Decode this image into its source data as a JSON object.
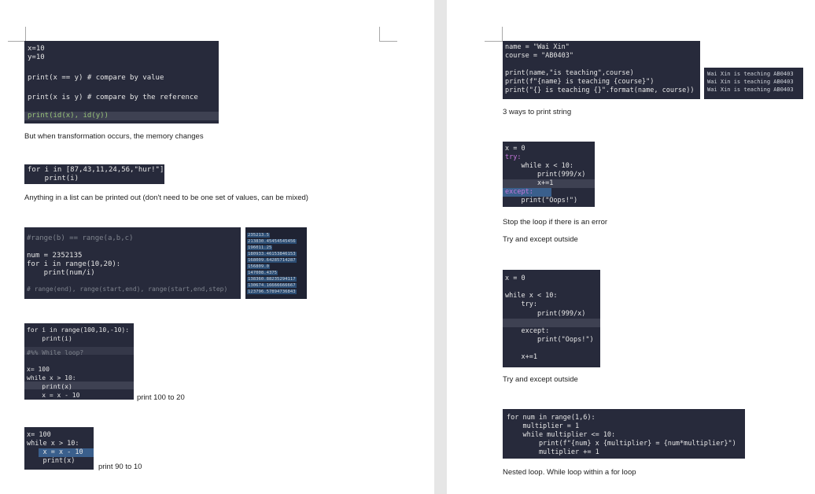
{
  "page1": {
    "block1": {
      "lines": [
        "x=10",
        "y=10",
        "print(x == y) # compare by value",
        "print(x is y) # compare by the reference",
        "print(id(x), id(y))"
      ]
    },
    "note1": "But when transformation occurs, the memory changes",
    "block2": {
      "lines": [
        "for i in [87,43,11,24,56,\"hur!\"]:",
        "    print(i)"
      ]
    },
    "note2": "Anything in a list can be printed out (don't need to be one set of values, can be mixed)",
    "block3": {
      "lines": [
        "#range(b) == range(a,b,c)",
        "num = 2352135",
        "for i in range(10,20):",
        "    print(num/i)",
        "# range(end), range(start,end), range(start,end,step)"
      ],
      "outputs": [
        "235213.5",
        "213830.45454545456",
        "196011.25",
        "180933.46153846153",
        "168009.64285714287",
        "156809.0",
        "147008.4375",
        "138360.88235294117",
        "130674.16666666667",
        "123796.57894736843"
      ]
    },
    "block4": {
      "lines": [
        "for i in range(100,10,-10):",
        "    print(i)",
        "#%% While loop?",
        "x= 100",
        "while x > 10:",
        "    print(x)",
        "    x = x - 10"
      ]
    },
    "note4": "print 100 to 20",
    "block5": {
      "lines": [
        "x= 100",
        "while x > 10:",
        "    x = x - 10",
        "    print(x)"
      ]
    },
    "note5": "print 90 to 10"
  },
  "page2": {
    "block1": {
      "lines": [
        "name = \"Wai Xin\"",
        "course = \"AB0403\"",
        "print(name,\"is teaching\",course)",
        "print(f\"{name} is teaching {course}\")",
        "print(\"{} is teaching {}\".format(name, course))"
      ],
      "outputs": [
        "Wai Xin is teaching AB0403",
        "Wai Xin is teaching AB0403",
        "Wai Xin is teaching AB0403"
      ]
    },
    "note1": "3 ways to print string",
    "block2": {
      "lines": [
        "x = 0",
        "try:",
        "    while x < 10:",
        "        print(999/x)",
        "        x+=1",
        "except:",
        "    print(\"Oops!\")"
      ]
    },
    "note2a": "Stop the loop if there is an error",
    "note2b": "Try and except outside",
    "block3": {
      "lines": [
        "x = 0",
        "while x < 10:",
        "    try:",
        "        print(999/x)",
        "    except:",
        "        print(\"Oops!\")",
        "    x+=1"
      ]
    },
    "note3": "Try and except outside",
    "block4": {
      "lines": [
        "for num in range(1,6):",
        "    multiplier = 1",
        "    while multiplier <= 10:",
        "        print(f\"{num} x {multiplier} = {num*multiplier}\")",
        "        multiplier += 1"
      ]
    },
    "note4": "Nested loop. While loop within a for loop"
  }
}
